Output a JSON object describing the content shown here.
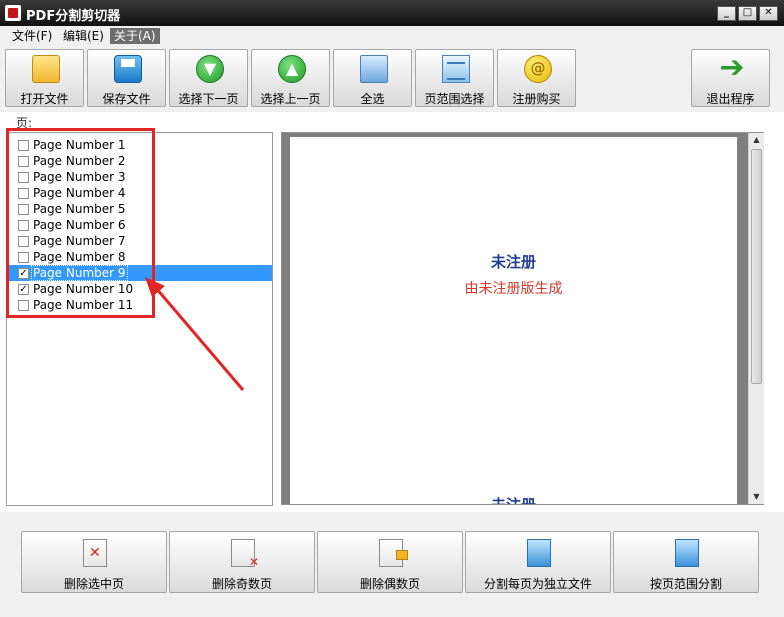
{
  "window": {
    "title": "PDF分割剪切器"
  },
  "menu": [
    {
      "label": "文件(F)"
    },
    {
      "label": "编辑(E)"
    },
    {
      "label": "关于(A)"
    }
  ],
  "toolbar": {
    "open": "打开文件",
    "save": "保存文件",
    "select_next": "选择下一页",
    "select_prev": "选择上一页",
    "select_all": "全选",
    "range_select": "页范围选择",
    "register": "注册购买",
    "exit": "退出程序"
  },
  "page_list": {
    "label": "页:",
    "items": [
      {
        "text": "Page Number 1",
        "checked": false
      },
      {
        "text": "Page Number 2",
        "checked": false
      },
      {
        "text": "Page Number 3",
        "checked": false
      },
      {
        "text": "Page Number 4",
        "checked": false
      },
      {
        "text": "Page Number 5",
        "checked": false
      },
      {
        "text": "Page Number 6",
        "checked": false
      },
      {
        "text": "Page Number 7",
        "checked": false
      },
      {
        "text": "Page Number 8",
        "checked": false
      },
      {
        "text": "Page Number 9",
        "checked": true,
        "selected": true
      },
      {
        "text": "Page Number 10",
        "checked": true
      },
      {
        "text": "Page Number 11",
        "checked": false
      }
    ]
  },
  "preview": {
    "watermark_title": "未注册",
    "watermark_subtitle": "由未注册版生成",
    "watermark_title_2": "未注册"
  },
  "bottom_buttons": {
    "delete_selected": "删除选中页",
    "delete_odd": "删除奇数页",
    "delete_even": "删除偶数页",
    "split_each": "分割每页为独立文件",
    "split_range": "按页范围分割"
  },
  "colors": {
    "selection": "#3399ff",
    "annotation": "#e22424",
    "watermark_blue": "#1f3f8c",
    "watermark_red": "#d33a2e"
  }
}
